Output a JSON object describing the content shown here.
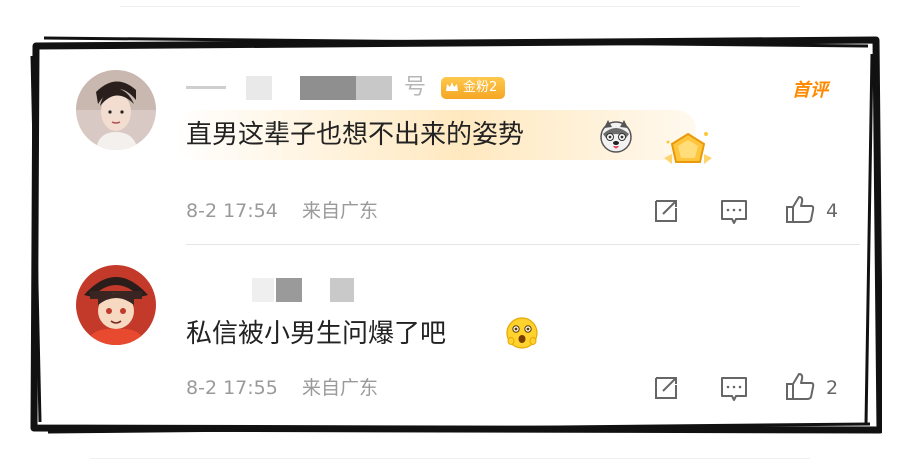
{
  "colors": {
    "accent_orange": "#ff8a00",
    "badge_gold": "#f5a623",
    "text_dark": "#222222",
    "meta_gray": "#9a9a9a"
  },
  "comments": [
    {
      "username_visible": "号",
      "badge_label": "金粉2",
      "tag": "首评",
      "text": "直男这辈子也想不出来的姿势",
      "emoji": "husky-dog-emoji",
      "date_time": "8-2 17:54",
      "location": "来自广东",
      "likes": "4"
    },
    {
      "text": "私信被小男生问爆了吧",
      "emoji": "shocked-face-emoji",
      "date_time": "8-2 17:55",
      "location": "来自广东",
      "likes": "2"
    }
  ]
}
